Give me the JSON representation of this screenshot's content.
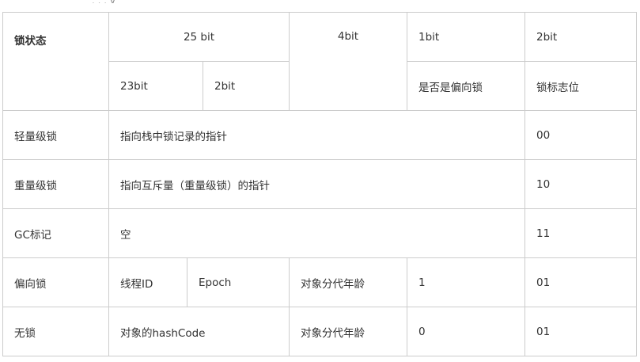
{
  "table": {
    "header": {
      "state": "锁状态",
      "bits25": "25 bit",
      "bits4": "4bit",
      "bit1": "1bit",
      "bits2": "2bit",
      "bits23": "23bit",
      "bits2b": "2bit",
      "biased_flag": "是否是偏向锁",
      "lock_flag": "锁标志位"
    },
    "rows": [
      {
        "state": "轻量级锁",
        "content": "指向栈中锁记录的指针",
        "flag": "00"
      },
      {
        "state": "重量级锁",
        "content": "指向互斥量（重量级锁）的指针",
        "flag": "10"
      },
      {
        "state": "GC标记",
        "content": "空",
        "flag": "11"
      },
      {
        "state": "偏向锁",
        "thread": "线程ID",
        "epoch": "Epoch",
        "age": "对象分代年龄",
        "biased": "1",
        "flag": "01"
      },
      {
        "state": "无锁",
        "hash": "对象的hashCode",
        "age": "对象分代年龄",
        "biased": "0",
        "flag": "01"
      }
    ]
  }
}
